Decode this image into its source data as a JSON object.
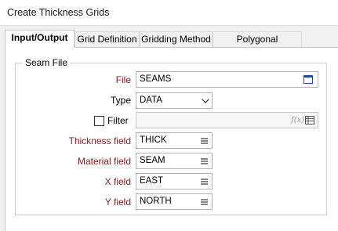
{
  "window": {
    "title": "Create Thickness Grids"
  },
  "tabs": [
    {
      "label": "Input/Output",
      "active": true
    },
    {
      "label": "Grid Definition",
      "active": false
    },
    {
      "label": "Gridding Method",
      "active": false
    },
    {
      "label": "Polygonal Restriction",
      "active": false
    }
  ],
  "seam_file": {
    "group_title": "Seam File",
    "file": {
      "label": "File",
      "value": "SEAMS"
    },
    "type": {
      "label": "Type",
      "value": "DATA"
    },
    "filter": {
      "label": "Filter",
      "checked": false,
      "value": "",
      "expr_glyph": "f(x)"
    },
    "thickness": {
      "label": "Thickness field",
      "value": "THICK"
    },
    "material": {
      "label": "Material field",
      "value": "SEAM"
    },
    "x": {
      "label": "X field",
      "value": "EAST"
    },
    "y": {
      "label": "Y field",
      "value": "NORTH"
    }
  },
  "colors": {
    "required_label": "#8b1a1a"
  }
}
